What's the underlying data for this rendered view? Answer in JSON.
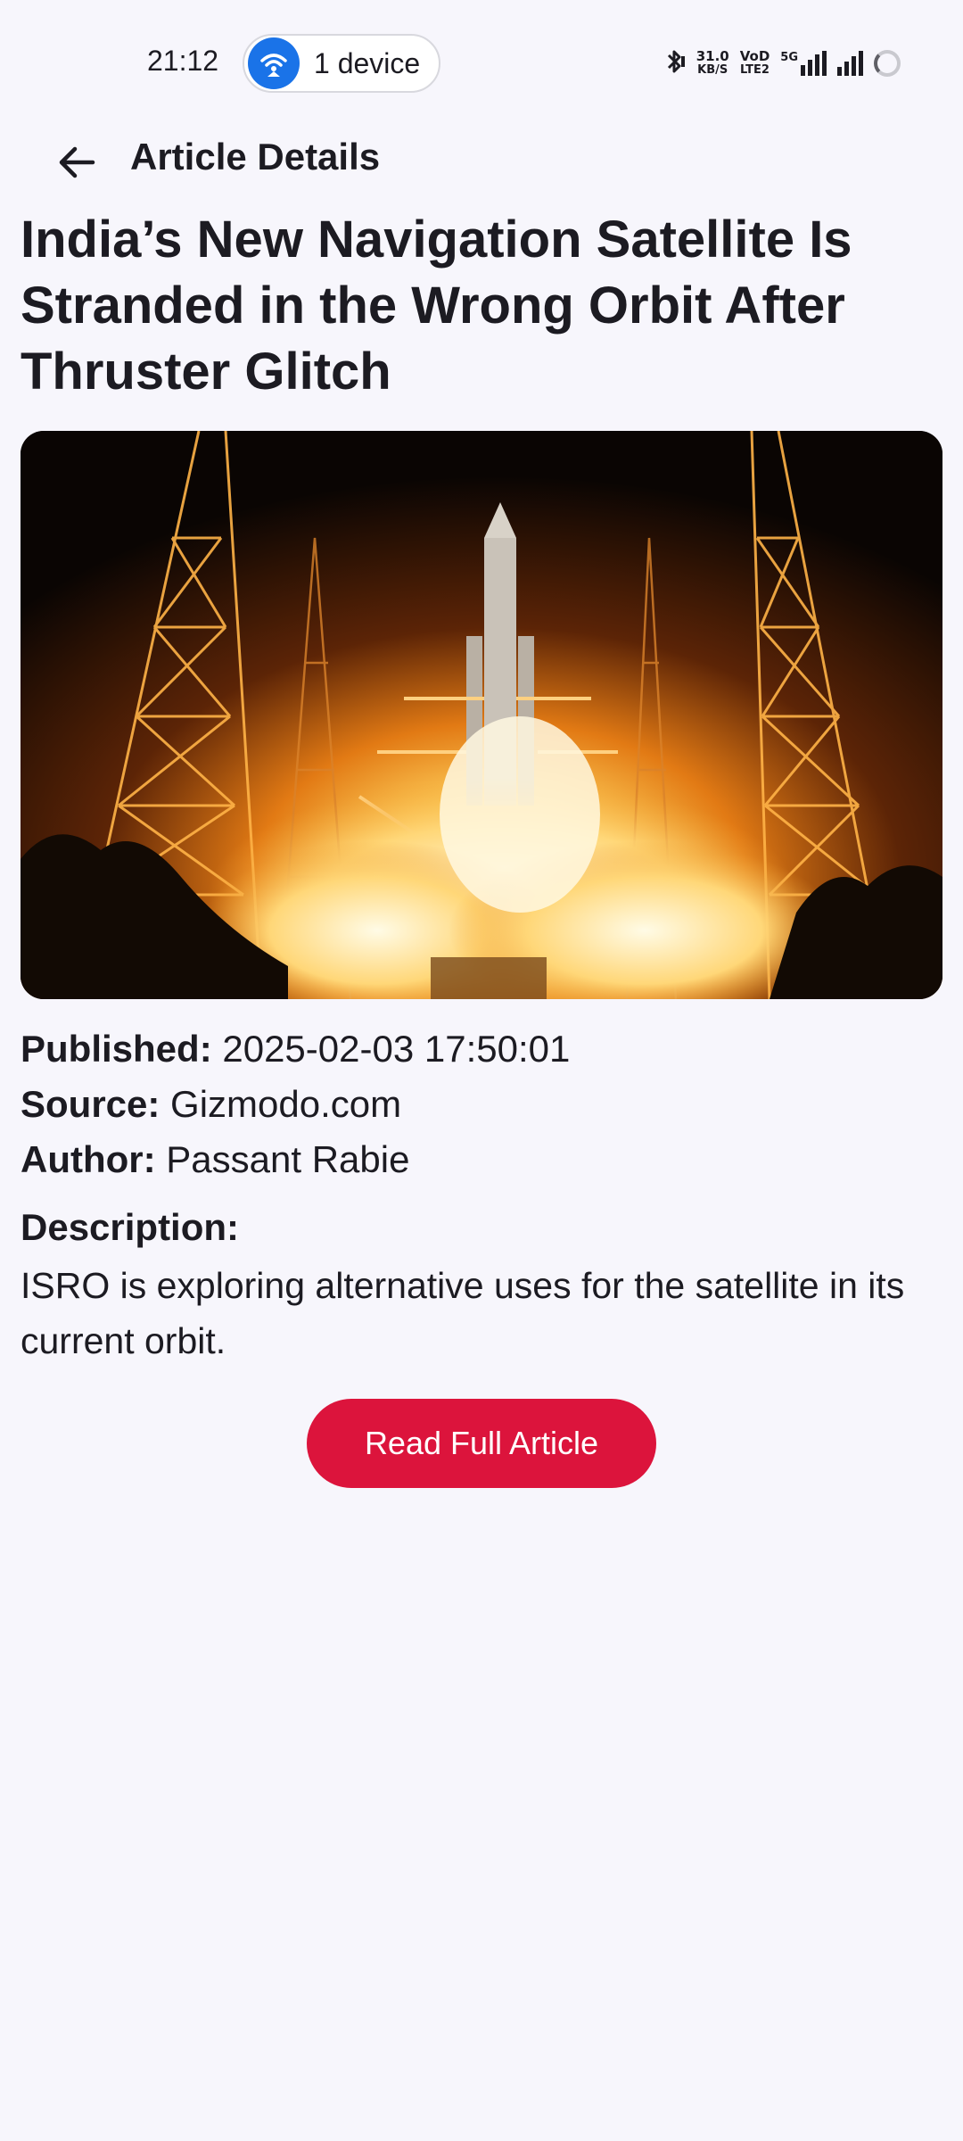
{
  "status_bar": {
    "time": "21:12",
    "hotspot_label": "1 device",
    "net_speed_value": "31.0",
    "net_speed_unit": "KB/S",
    "volte_top": "VoD",
    "volte_bottom": "LTE2",
    "network_type": "5G"
  },
  "app_bar": {
    "title": "Article Details"
  },
  "article": {
    "title": "India’s New Navigation Satellite Is Stranded in the Wrong Orbit After Thruster Glitch",
    "published_label": "Published:",
    "published_value": "2025-02-03  17:50:01",
    "source_label": "Source:",
    "source_value": "Gizmodo.com",
    "author_label": "Author:",
    "author_value": "Passant Rabie",
    "description_label": "Description:",
    "description_value": "ISRO is exploring alternative uses for the satellite in its current orbit.",
    "read_button_label": "Read Full Article"
  },
  "colors": {
    "background": "#f7f6fc",
    "accent_button": "#dc143c",
    "hotspot_icon": "#1a73e8"
  },
  "icons": {
    "back": "arrow-left-icon",
    "hotspot": "wifi-hotspot-icon",
    "bluetooth": "bluetooth-icon"
  }
}
